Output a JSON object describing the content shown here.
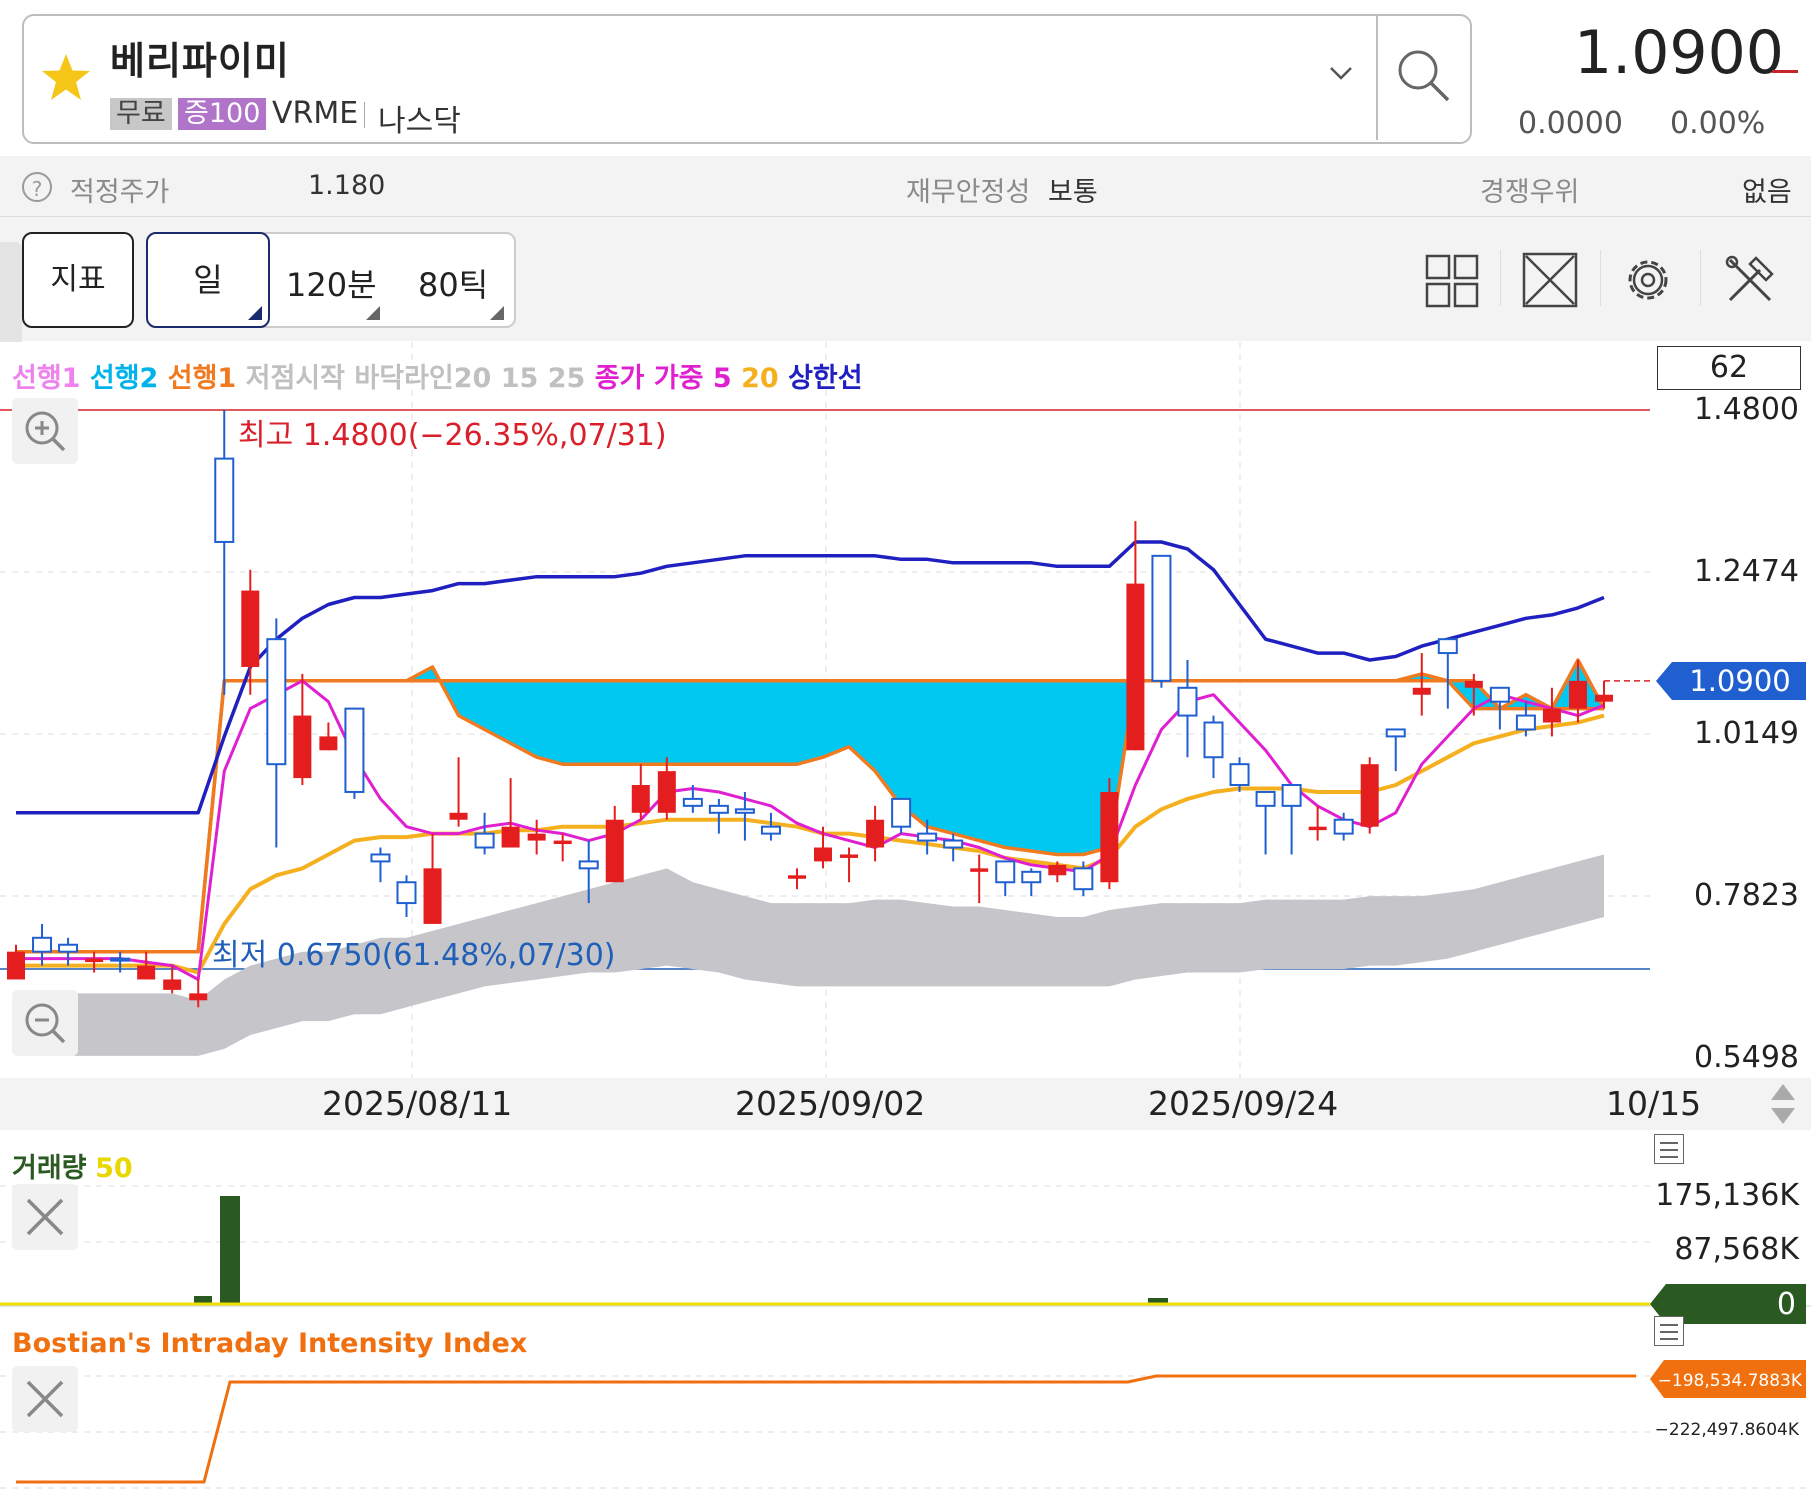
{
  "stock": {
    "name": "베리파이미",
    "tag_free": "무료",
    "tag_margin": "증100",
    "ticker": "VRME",
    "market": "나스닥",
    "price": "1.0900",
    "change": "0.0000",
    "change_pct": "0.00%"
  },
  "info": {
    "fair_price_label": "적정주가",
    "fair_price_value": "1.180",
    "stability_label": "재무안정성",
    "stability_value": "보통",
    "advantage_label": "경쟁우위",
    "advantage_value": "없음"
  },
  "toolbar": {
    "indicator": "지표",
    "periods": [
      "일",
      "120분",
      "80틱"
    ],
    "icons": [
      "layout-grid-icon",
      "expand-icon",
      "settings-gear-icon",
      "tools-icon"
    ]
  },
  "chart_data": {
    "type": "candlestick",
    "legend": [
      {
        "text": "선행1",
        "color": "#ee82ee"
      },
      {
        "text": "선행2",
        "color": "#00b4ea"
      },
      {
        "text": "선행1",
        "color": "#f07a20"
      },
      {
        "text": "저점시작",
        "color": "#c0c0c0"
      },
      {
        "text": "바닥라인20",
        "color": "#c0c0c0"
      },
      {
        "text": "15",
        "color": "#c0c0c0"
      },
      {
        "text": "25",
        "color": "#c0c0c0"
      },
      {
        "text": "종가",
        "color": "#e020d0"
      },
      {
        "text": "가중",
        "color": "#e020d0"
      },
      {
        "text": "5",
        "color": "#e020d0"
      },
      {
        "text": "20",
        "color": "#f5b020"
      },
      {
        "text": "상한선",
        "color": "#2020c0"
      }
    ],
    "box_value": "62",
    "y_ticks": [
      "1.4800",
      "1.2474",
      "1.0149",
      "0.7823",
      "0.5498"
    ],
    "ylim": [
      0.5498,
      1.48
    ],
    "current_price": "1.0900",
    "high_annotation": "최고 1.4800(−26.35%,07/31)",
    "low_annotation": "최저 0.6750(61.48%,07/30)",
    "x_labels": [
      "2025/08/11",
      "2025/09/02",
      "2025/09/24",
      "10/15"
    ],
    "candles": [
      {
        "o": 0.7,
        "h": 0.71,
        "l": 0.66,
        "c": 0.66
      },
      {
        "o": 0.7,
        "h": 0.74,
        "l": 0.68,
        "c": 0.72
      },
      {
        "o": 0.7,
        "h": 0.72,
        "l": 0.68,
        "c": 0.71
      },
      {
        "o": 0.69,
        "h": 0.7,
        "l": 0.67,
        "c": 0.685
      },
      {
        "o": 0.69,
        "h": 0.7,
        "l": 0.67,
        "c": 0.69
      },
      {
        "o": 0.68,
        "h": 0.7,
        "l": 0.66,
        "c": 0.66
      },
      {
        "o": 0.66,
        "h": 0.68,
        "l": 0.64,
        "c": 0.645
      },
      {
        "o": 0.64,
        "h": 0.66,
        "l": 0.62,
        "c": 0.63
      },
      {
        "o": 1.29,
        "h": 1.48,
        "l": 1.07,
        "c": 1.41
      },
      {
        "o": 1.22,
        "h": 1.25,
        "l": 1.07,
        "c": 1.11
      },
      {
        "o": 0.97,
        "h": 1.18,
        "l": 0.85,
        "c": 1.15
      },
      {
        "o": 1.04,
        "h": 1.1,
        "l": 0.94,
        "c": 0.95
      },
      {
        "o": 1.01,
        "h": 1.03,
        "l": 0.99,
        "c": 0.99
      },
      {
        "o": 0.93,
        "h": 1.05,
        "l": 0.92,
        "c": 1.05
      },
      {
        "o": 0.83,
        "h": 0.85,
        "l": 0.8,
        "c": 0.84
      },
      {
        "o": 0.77,
        "h": 0.81,
        "l": 0.75,
        "c": 0.8
      },
      {
        "o": 0.82,
        "h": 0.87,
        "l": 0.74,
        "c": 0.74
      },
      {
        "o": 0.9,
        "h": 0.98,
        "l": 0.88,
        "c": 0.89
      },
      {
        "o": 0.85,
        "h": 0.9,
        "l": 0.84,
        "c": 0.87
      },
      {
        "o": 0.88,
        "h": 0.95,
        "l": 0.85,
        "c": 0.85
      },
      {
        "o": 0.87,
        "h": 0.89,
        "l": 0.84,
        "c": 0.86
      },
      {
        "o": 0.86,
        "h": 0.87,
        "l": 0.83,
        "c": 0.855
      },
      {
        "o": 0.82,
        "h": 0.86,
        "l": 0.77,
        "c": 0.83
      },
      {
        "o": 0.89,
        "h": 0.91,
        "l": 0.8,
        "c": 0.8
      },
      {
        "o": 0.94,
        "h": 0.97,
        "l": 0.89,
        "c": 0.9
      },
      {
        "o": 0.96,
        "h": 0.98,
        "l": 0.89,
        "c": 0.9
      },
      {
        "o": 0.91,
        "h": 0.94,
        "l": 0.9,
        "c": 0.92
      },
      {
        "o": 0.9,
        "h": 0.92,
        "l": 0.87,
        "c": 0.91
      },
      {
        "o": 0.9,
        "h": 0.93,
        "l": 0.86,
        "c": 0.905
      },
      {
        "o": 0.87,
        "h": 0.9,
        "l": 0.86,
        "c": 0.88
      },
      {
        "o": 0.81,
        "h": 0.82,
        "l": 0.79,
        "c": 0.805
      },
      {
        "o": 0.85,
        "h": 0.88,
        "l": 0.82,
        "c": 0.83
      },
      {
        "o": 0.84,
        "h": 0.85,
        "l": 0.8,
        "c": 0.835
      },
      {
        "o": 0.89,
        "h": 0.91,
        "l": 0.83,
        "c": 0.85
      },
      {
        "o": 0.88,
        "h": 0.92,
        "l": 0.87,
        "c": 0.92
      },
      {
        "o": 0.86,
        "h": 0.89,
        "l": 0.84,
        "c": 0.87
      },
      {
        "o": 0.85,
        "h": 0.87,
        "l": 0.83,
        "c": 0.86
      },
      {
        "o": 0.82,
        "h": 0.84,
        "l": 0.77,
        "c": 0.815
      },
      {
        "o": 0.8,
        "h": 0.83,
        "l": 0.78,
        "c": 0.83
      },
      {
        "o": 0.8,
        "h": 0.82,
        "l": 0.78,
        "c": 0.815
      },
      {
        "o": 0.825,
        "h": 0.83,
        "l": 0.8,
        "c": 0.81
      },
      {
        "o": 0.79,
        "h": 0.83,
        "l": 0.78,
        "c": 0.82
      },
      {
        "o": 0.93,
        "h": 0.95,
        "l": 0.79,
        "c": 0.8
      },
      {
        "o": 1.23,
        "h": 1.32,
        "l": 0.99,
        "c": 0.99
      },
      {
        "o": 1.09,
        "h": 1.27,
        "l": 1.08,
        "c": 1.27
      },
      {
        "o": 1.04,
        "h": 1.12,
        "l": 0.98,
        "c": 1.08
      },
      {
        "o": 0.98,
        "h": 1.04,
        "l": 0.95,
        "c": 1.03
      },
      {
        "o": 0.94,
        "h": 0.98,
        "l": 0.93,
        "c": 0.97
      },
      {
        "o": 0.91,
        "h": 0.93,
        "l": 0.84,
        "c": 0.93
      },
      {
        "o": 0.91,
        "h": 0.94,
        "l": 0.84,
        "c": 0.94
      },
      {
        "o": 0.88,
        "h": 0.91,
        "l": 0.86,
        "c": 0.875
      },
      {
        "o": 0.87,
        "h": 0.9,
        "l": 0.86,
        "c": 0.89
      },
      {
        "o": 0.97,
        "h": 0.98,
        "l": 0.87,
        "c": 0.88
      },
      {
        "o": 1.01,
        "h": 1.02,
        "l": 0.96,
        "c": 1.02
      },
      {
        "o": 1.08,
        "h": 1.13,
        "l": 1.04,
        "c": 1.07
      },
      {
        "o": 1.13,
        "h": 1.14,
        "l": 1.05,
        "c": 1.15
      },
      {
        "o": 1.09,
        "h": 1.1,
        "l": 1.04,
        "c": 1.08
      },
      {
        "o": 1.06,
        "h": 1.07,
        "l": 1.02,
        "c": 1.08
      },
      {
        "o": 1.02,
        "h": 1.06,
        "l": 1.01,
        "c": 1.04
      },
      {
        "o": 1.05,
        "h": 1.08,
        "l": 1.01,
        "c": 1.03
      },
      {
        "o": 1.09,
        "h": 1.12,
        "l": 1.03,
        "c": 1.05
      },
      {
        "o": 1.07,
        "h": 1.09,
        "l": 1.05,
        "c": 1.06
      }
    ],
    "upper_line": [
      0.9,
      0.9,
      0.9,
      0.9,
      0.9,
      0.9,
      0.9,
      0.9,
      1.01,
      1.11,
      1.15,
      1.18,
      1.2,
      1.21,
      1.21,
      1.215,
      1.22,
      1.23,
      1.23,
      1.235,
      1.24,
      1.24,
      1.24,
      1.24,
      1.245,
      1.255,
      1.26,
      1.265,
      1.27,
      1.27,
      1.27,
      1.27,
      1.27,
      1.27,
      1.265,
      1.265,
      1.26,
      1.26,
      1.26,
      1.26,
      1.255,
      1.255,
      1.255,
      1.29,
      1.29,
      1.28,
      1.25,
      1.2,
      1.15,
      1.14,
      1.13,
      1.13,
      1.12,
      1.125,
      1.14,
      1.15,
      1.16,
      1.17,
      1.18,
      1.185,
      1.195,
      1.21
    ],
    "senkou1": [
      0.7,
      0.7,
      0.7,
      0.7,
      0.7,
      0.7,
      0.7,
      0.7,
      1.09,
      1.09,
      1.09,
      1.09,
      1.09,
      1.09,
      1.09,
      1.09,
      1.11,
      1.04,
      1.02,
      1.0,
      0.98,
      0.97,
      0.97,
      0.97,
      0.97,
      0.97,
      0.97,
      0.97,
      0.97,
      0.97,
      0.97,
      0.98,
      0.995,
      0.96,
      0.91,
      0.88,
      0.87,
      0.86,
      0.85,
      0.845,
      0.84,
      0.84,
      0.85,
      1.09,
      1.09,
      1.09,
      1.09,
      1.09,
      1.09,
      1.09,
      1.09,
      1.09,
      1.09,
      1.09,
      1.1,
      1.09,
      1.05,
      1.05,
      1.05,
      1.05,
      1.05,
      1.05
    ],
    "senkou2": [
      0.7,
      0.7,
      0.7,
      0.7,
      0.7,
      0.7,
      0.7,
      0.7,
      1.09,
      1.09,
      1.09,
      1.09,
      1.09,
      1.09,
      1.09,
      1.09,
      1.09,
      1.09,
      1.09,
      1.09,
      1.09,
      1.09,
      1.09,
      1.09,
      1.09,
      1.09,
      1.09,
      1.09,
      1.09,
      1.09,
      1.09,
      1.09,
      1.09,
      1.09,
      1.09,
      1.09,
      1.09,
      1.09,
      1.09,
      1.09,
      1.09,
      1.09,
      1.09,
      1.09,
      1.09,
      1.09,
      1.09,
      1.09,
      1.09,
      1.09,
      1.09,
      1.09,
      1.09,
      1.09,
      1.09,
      1.09,
      1.09,
      1.05,
      1.07,
      1.05,
      1.12,
      1.05
    ],
    "ma5": [
      0.69,
      0.69,
      0.69,
      0.69,
      0.69,
      0.685,
      0.68,
      0.66,
      0.96,
      1.05,
      1.07,
      1.09,
      1.06,
      0.98,
      0.92,
      0.88,
      0.87,
      0.87,
      0.88,
      0.885,
      0.875,
      0.87,
      0.86,
      0.87,
      0.89,
      0.93,
      0.935,
      0.93,
      0.92,
      0.91,
      0.885,
      0.87,
      0.86,
      0.85,
      0.87,
      0.865,
      0.86,
      0.85,
      0.835,
      0.825,
      0.82,
      0.815,
      0.84,
      0.94,
      1.02,
      1.06,
      1.07,
      1.03,
      0.99,
      0.94,
      0.91,
      0.89,
      0.88,
      0.9,
      0.97,
      1.01,
      1.05,
      1.07,
      1.06,
      1.05,
      1.04,
      1.055
    ],
    "ma20": [
      0.68,
      0.68,
      0.68,
      0.68,
      0.68,
      0.68,
      0.68,
      0.67,
      0.74,
      0.79,
      0.81,
      0.82,
      0.84,
      0.86,
      0.865,
      0.865,
      0.87,
      0.87,
      0.87,
      0.875,
      0.875,
      0.88,
      0.88,
      0.88,
      0.885,
      0.89,
      0.89,
      0.89,
      0.89,
      0.885,
      0.88,
      0.87,
      0.87,
      0.865,
      0.86,
      0.855,
      0.85,
      0.845,
      0.835,
      0.83,
      0.825,
      0.82,
      0.835,
      0.88,
      0.905,
      0.92,
      0.93,
      0.935,
      0.935,
      0.935,
      0.93,
      0.93,
      0.93,
      0.94,
      0.96,
      0.98,
      1.0,
      1.01,
      1.02,
      1.025,
      1.03,
      1.04
    ],
    "cloud_top": [
      0.64,
      0.64,
      0.64,
      0.64,
      0.64,
      0.64,
      0.64,
      0.63,
      0.66,
      0.68,
      0.69,
      0.7,
      0.7,
      0.71,
      0.72,
      0.72,
      0.73,
      0.74,
      0.75,
      0.76,
      0.77,
      0.78,
      0.79,
      0.8,
      0.81,
      0.82,
      0.8,
      0.79,
      0.78,
      0.77,
      0.77,
      0.77,
      0.77,
      0.775,
      0.775,
      0.77,
      0.765,
      0.765,
      0.76,
      0.755,
      0.75,
      0.75,
      0.76,
      0.765,
      0.77,
      0.77,
      0.77,
      0.77,
      0.775,
      0.775,
      0.775,
      0.775,
      0.78,
      0.78,
      0.78,
      0.785,
      0.79,
      0.8,
      0.81,
      0.82,
      0.83,
      0.84
    ],
    "cloud_bottom": [
      0.55,
      0.55,
      0.55,
      0.55,
      0.55,
      0.55,
      0.55,
      0.55,
      0.56,
      0.58,
      0.59,
      0.6,
      0.6,
      0.61,
      0.61,
      0.62,
      0.63,
      0.64,
      0.65,
      0.655,
      0.66,
      0.665,
      0.67,
      0.67,
      0.675,
      0.68,
      0.675,
      0.67,
      0.66,
      0.655,
      0.65,
      0.65,
      0.65,
      0.65,
      0.65,
      0.65,
      0.65,
      0.65,
      0.65,
      0.65,
      0.65,
      0.65,
      0.65,
      0.66,
      0.665,
      0.67,
      0.67,
      0.67,
      0.675,
      0.675,
      0.675,
      0.675,
      0.68,
      0.68,
      0.685,
      0.69,
      0.7,
      0.71,
      0.72,
      0.73,
      0.74,
      0.75
    ]
  },
  "volume": {
    "title": "거래량",
    "period": "50",
    "y_ticks": [
      "175,136K",
      "87,568K"
    ],
    "current": "0"
  },
  "bostian": {
    "title": "Bostian's Intraday Intensity Index",
    "current": "−198,534.7883K",
    "tick": "−222,497.8604K"
  }
}
